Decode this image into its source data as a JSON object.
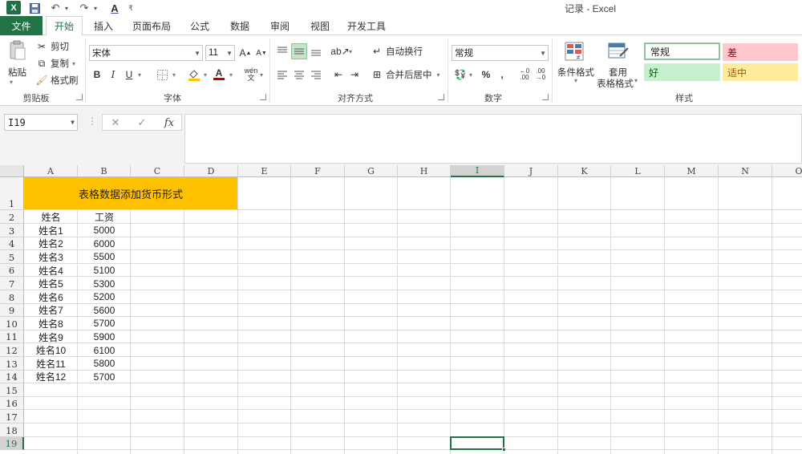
{
  "window": {
    "title": "记录 - Excel"
  },
  "tabs": [
    {
      "label": "文件"
    },
    {
      "label": "开始"
    },
    {
      "label": "插入"
    },
    {
      "label": "页面布局"
    },
    {
      "label": "公式"
    },
    {
      "label": "数据"
    },
    {
      "label": "审阅"
    },
    {
      "label": "视图"
    },
    {
      "label": "开发工具"
    }
  ],
  "ribbon": {
    "clipboard": {
      "paste": "粘贴",
      "cut": "剪切",
      "copy": "复制",
      "format_painter": "格式刷",
      "label": "剪贴板"
    },
    "font": {
      "name": "宋体",
      "size": "11",
      "label": "字体",
      "bold": "B",
      "italic": "I",
      "underline": "U"
    },
    "alignment": {
      "wrap": "自动换行",
      "merge": "合并后居中",
      "label": "对齐方式"
    },
    "number": {
      "format": "常规",
      "percent": "%",
      "comma": ",",
      "label": "数字"
    },
    "styles": {
      "conditional": "条件格式",
      "table_format": "套用",
      "table_format2": "表格格式",
      "normal": "常规",
      "bad": "差",
      "good": "好",
      "neutral": "适中",
      "label": "样式",
      "colors": {
        "normal_bg": "#ffffff",
        "bad_bg": "#ffc7ce",
        "bad_fg": "#9c0006",
        "good_bg": "#c6efce",
        "good_fg": "#006100",
        "neutral_bg": "#ffeb9c",
        "neutral_fg": "#9c5700"
      }
    }
  },
  "formula_bar": {
    "name_box": "I19",
    "fx": "fx",
    "value": ""
  },
  "grid": {
    "columns": [
      "A",
      "B",
      "C",
      "D",
      "E",
      "F",
      "G",
      "H",
      "I",
      "J",
      "K",
      "L",
      "M",
      "N",
      "O"
    ],
    "rows": [
      "1",
      "2",
      "3",
      "4",
      "5",
      "6",
      "7",
      "8",
      "9",
      "10",
      "11",
      "12",
      "13",
      "14",
      "15",
      "16",
      "17",
      "18",
      "19"
    ],
    "selected_cell": "I19",
    "title": "表格数据添加货币形式",
    "title_color": "#ffc000",
    "headers": {
      "name": "姓名",
      "salary": "工资"
    },
    "records": [
      {
        "name": "姓名1",
        "salary": "5000"
      },
      {
        "name": "姓名2",
        "salary": "6000"
      },
      {
        "name": "姓名3",
        "salary": "5500"
      },
      {
        "name": "姓名4",
        "salary": "5100"
      },
      {
        "name": "姓名5",
        "salary": "5300"
      },
      {
        "name": "姓名6",
        "salary": "5200"
      },
      {
        "name": "姓名7",
        "salary": "5600"
      },
      {
        "name": "姓名8",
        "salary": "5700"
      },
      {
        "name": "姓名9",
        "salary": "5900"
      },
      {
        "name": "姓名10",
        "salary": "6100"
      },
      {
        "name": "姓名11",
        "salary": "5800"
      },
      {
        "name": "姓名12",
        "salary": "5700"
      }
    ]
  },
  "accent": "#217346"
}
